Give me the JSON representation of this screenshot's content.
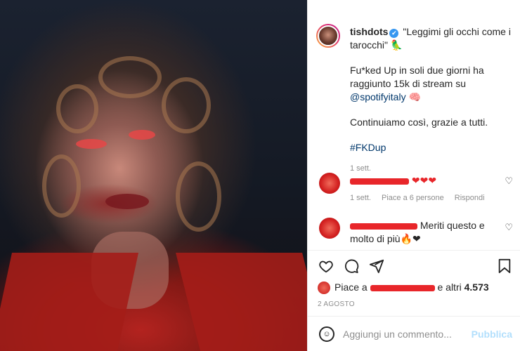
{
  "post": {
    "username": "tishdots",
    "verified_glyph": "✔",
    "caption_line1": "\"Leggimi gli occhi come i tarocchi\" 🦜",
    "caption_p2_a": "Fu*ked Up in soli due giorni ha raggiunto 15k di stream su",
    "caption_mention": "@spotifyitaly",
    "caption_p2_emoji": "🧠",
    "caption_p3": "Continuiamo così, grazie a tutti.",
    "caption_hashtag": "#FKDup",
    "caption_time": "1 sett."
  },
  "comments": [
    {
      "text": "❤❤❤",
      "meta_time": "1 sett.",
      "meta_likes": "Piace a 6 persone",
      "meta_reply": "Rispondi",
      "like_icon": "♡"
    },
    {
      "text": "Meriti questo e molto di più🔥❤",
      "like_icon": "♡"
    }
  ],
  "actions": {
    "like_icon": "♡",
    "comment_icon": "◯",
    "share_icon": "➤",
    "save_icon": "⊓"
  },
  "likes": {
    "prefix": "Piace a",
    "suffix_a": "e altri",
    "count": "4.573"
  },
  "date": "2 AGOSTO",
  "composer": {
    "emoji_icon": "☺",
    "placeholder": "Aggiungi un commento...",
    "publish_label": "Pubblica"
  },
  "colors": {
    "link": "#00376b",
    "muted": "#8e8e8e",
    "publish_disabled": "#b2dffc",
    "redaction": "#e8262a"
  }
}
